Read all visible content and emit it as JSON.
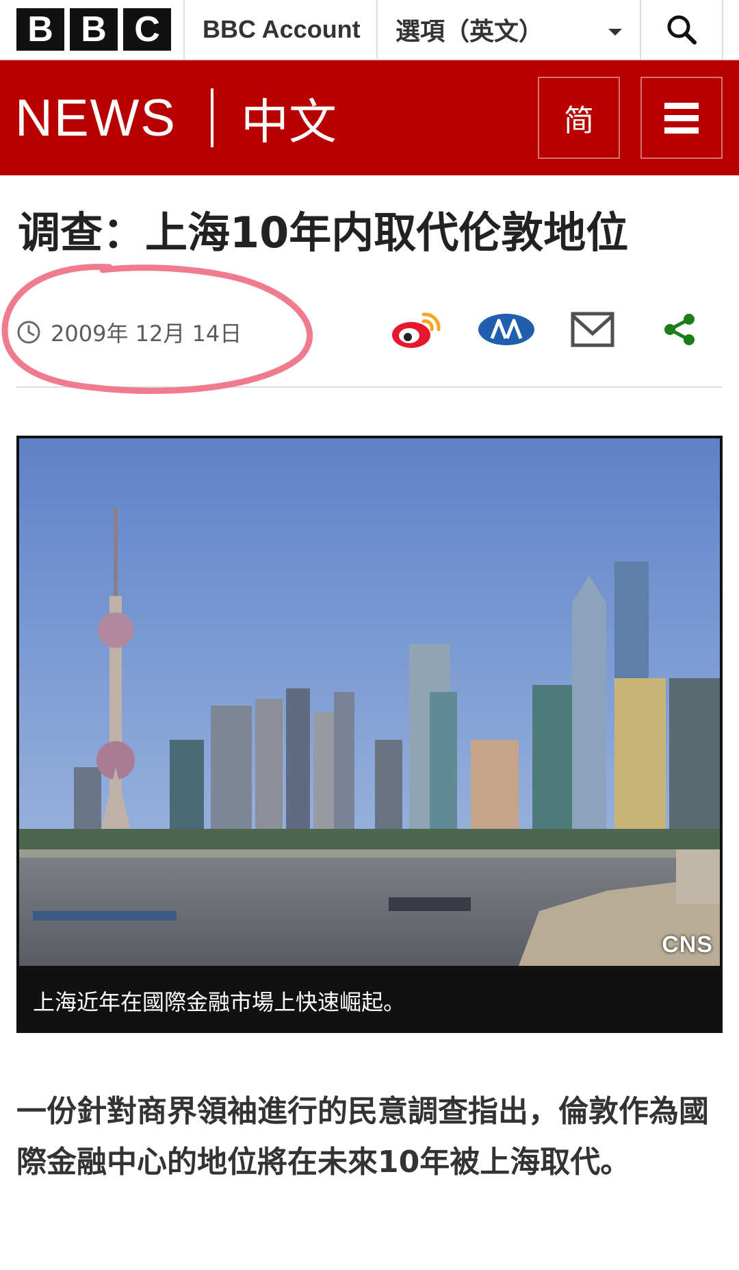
{
  "topbar": {
    "logo_letters": [
      "B",
      "B",
      "C"
    ],
    "account_label": "BBC Account",
    "options_label": "選項（英文）",
    "search_icon": "search-icon"
  },
  "banner": {
    "news_label": "NEWS",
    "section_label": "中文",
    "simplified_label": "简",
    "menu_icon": "hamburger-menu-icon"
  },
  "article": {
    "headline": "调查：上海10年内取代伦敦地位",
    "date": "2009年 12月 14日",
    "share_icons": [
      "weibo-icon",
      "renren-icon",
      "email-icon",
      "share-icon"
    ],
    "image_watermark": "CNS",
    "image_caption": "上海近年在國際金融市場上快速崛起。",
    "lead": "一份針對商界領袖進行的民意調查指出，倫敦作為國際金融中心的地位將在未來10年被上海取代。"
  },
  "colors": {
    "brand_red": "#b80000",
    "weibo_red": "#e6162d",
    "renren_blue": "#1f5fad",
    "share_green": "#1a7f1a",
    "annotation_pink": "#f07a8e"
  }
}
